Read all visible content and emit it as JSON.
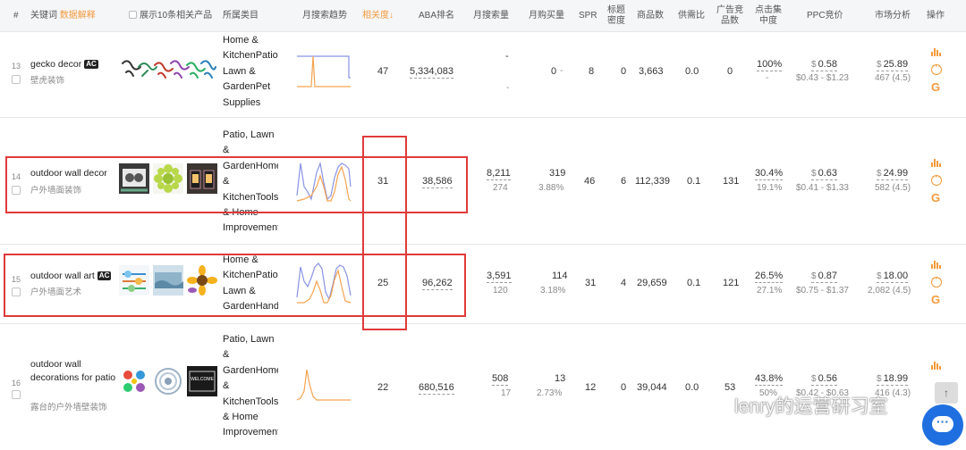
{
  "header": {
    "index": "#",
    "keyword": "关键词",
    "keyword_tip": "数据解释",
    "show_top10": "展示10条相关产品",
    "category": "所属类目",
    "monthly_trend": "月搜索趋势",
    "relevance": "相关度↓",
    "aba_rank": "ABA排名",
    "monthly_search": "月搜索量",
    "monthly_purchase": "月购买量",
    "spr": "SPR",
    "title_density": "标题密度",
    "product_count": "商品数",
    "supply_demand": "供需比",
    "ad_products": "广告竞品数",
    "click_concentration": "点击集中度",
    "ppc": "PPC竞价",
    "market": "市场分析",
    "ops": "操作"
  },
  "rows": [
    {
      "index": "13",
      "keyword": "gecko decor",
      "ac_badge": "AC",
      "keyword_zh": "壁虎装饰",
      "category": "Home & KitchenPatio, Lawn & GardenPet Supplies",
      "relevance": "47",
      "aba_rank": "5,334,083",
      "monthly_search": "-",
      "monthly_search_sub": "-",
      "monthly_purchase": "0",
      "monthly_purchase_sub": "-",
      "spr": "8",
      "title_density": "0",
      "product_count": "3,663",
      "supply_demand": "0.0",
      "ad_products": "0",
      "click_conc": "100%",
      "click_conc_sub": "-",
      "ppc": "0.58",
      "ppc_range": "$0.43 - $1.23",
      "market": "25.89",
      "market_sub": "467 (4.5)"
    },
    {
      "index": "14",
      "keyword": "outdoor wall decor",
      "ac_badge": "",
      "keyword_zh": "户外墙面装饰",
      "category": "Patio, Lawn & GardenHome & KitchenTools & Home Improvement",
      "relevance": "31",
      "aba_rank": "38,586",
      "monthly_search": "8,211",
      "monthly_search_sub": "274",
      "monthly_purchase": "319",
      "monthly_purchase_sub": "3.88%",
      "spr": "46",
      "title_density": "6",
      "product_count": "112,339",
      "supply_demand": "0.1",
      "ad_products": "131",
      "click_conc": "30.4%",
      "click_conc_sub": "19.1%",
      "ppc": "0.63",
      "ppc_range": "$0.41 - $1.33",
      "market": "24.99",
      "market_sub": "582 (4.5)"
    },
    {
      "index": "15",
      "keyword": "outdoor wall art",
      "ac_badge": "AC",
      "keyword_zh": "户外墙面艺术",
      "category": "Home & KitchenPatio, Lawn & GardenHandmade",
      "relevance": "25",
      "aba_rank": "96,262",
      "monthly_search": "3,591",
      "monthly_search_sub": "120",
      "monthly_purchase": "114",
      "monthly_purchase_sub": "3.18%",
      "spr": "31",
      "title_density": "4",
      "product_count": "29,659",
      "supply_demand": "0.1",
      "ad_products": "121",
      "click_conc": "26.5%",
      "click_conc_sub": "27.1%",
      "ppc": "0.87",
      "ppc_range": "$0.75 - $1.37",
      "market": "18.00",
      "market_sub": "2,082 (4.5)"
    },
    {
      "index": "16",
      "keyword": "outdoor wall decorations for patio",
      "ac_badge": "",
      "keyword_zh": "露台的户外墙壁装饰",
      "category": "Patio, Lawn & GardenHome & KitchenTools & Home Improvement",
      "relevance": "22",
      "aba_rank": "680,516",
      "monthly_search": "508",
      "monthly_search_sub": "17",
      "monthly_purchase": "13",
      "monthly_purchase_sub": "2.73%",
      "spr": "12",
      "title_density": "0",
      "product_count": "39,044",
      "supply_demand": "0.0",
      "ad_products": "53",
      "click_conc": "43.8%",
      "click_conc_sub": "50%",
      "ppc": "0.56",
      "ppc_range": "$0.42 - $0.63",
      "market": "18.99",
      "market_sub": "416 (4.3)"
    }
  ],
  "thumb_sign_text": "WELCOME",
  "action_icons": [
    "bar-chart-icon",
    "more-icon",
    "google-icon"
  ],
  "watermark": "lenry的运营研习室",
  "colors": {
    "accent": "#f39a3b",
    "highlight_border": "#e03a3a",
    "trend_line_blue": "#8a93e6",
    "trend_line_orange": "#f5a350",
    "chat_button": "#1f6fe0"
  }
}
